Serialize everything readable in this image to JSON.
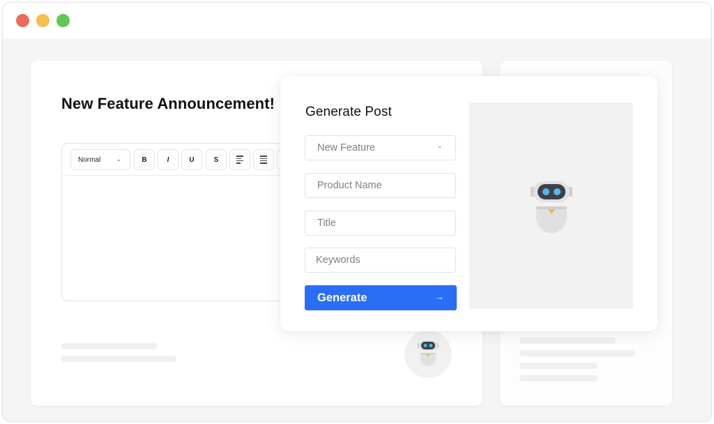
{
  "window": {
    "controls": [
      {
        "name": "close",
        "color": "#ee6a5f"
      },
      {
        "name": "minimize",
        "color": "#f5be4f"
      },
      {
        "name": "maximize",
        "color": "#62c554"
      }
    ]
  },
  "document": {
    "title": "New Feature Announcement!",
    "toolbar": {
      "text_style": "Normal",
      "bold": "B",
      "italic": "I",
      "underline": "U",
      "strike": "S"
    }
  },
  "generate_post": {
    "title": "Generate Post",
    "post_type": {
      "value": "New Feature"
    },
    "product_name": {
      "value": "",
      "placeholder": "Product Name"
    },
    "post_title": {
      "value": "",
      "placeholder": "Title"
    },
    "keywords": {
      "value": "",
      "placeholder": "Keywords"
    },
    "generate_label": "Generate",
    "accent_color": "#2b6ef6"
  }
}
